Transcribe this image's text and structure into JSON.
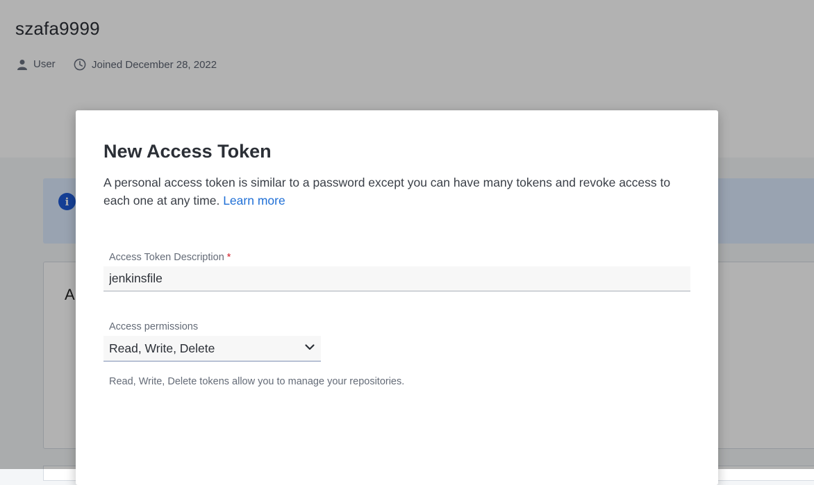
{
  "profile": {
    "username": "szafa9999",
    "role": "User",
    "joined": "Joined December 28, 2022"
  },
  "background": {
    "info_icon": "i",
    "card_heading_partial": "A"
  },
  "modal": {
    "title": "New Access Token",
    "description": "A personal access token is similar to a password except you can have many tokens and revoke access to each one at any time. ",
    "learn_more": "Learn more",
    "description_label": "Access Token Description",
    "required_marker": "*",
    "description_value": "jenkinsfile",
    "permissions_label": "Access permissions",
    "permissions_value": "Read, Write, Delete",
    "permissions_helper": "Read, Write, Delete tokens allow you to manage your repositories."
  },
  "icons": {
    "user": "user-icon",
    "clock": "clock-icon",
    "info": "info-icon",
    "chevron": "chevron-down-icon"
  },
  "colors": {
    "link": "#1f6fd6",
    "required": "#d1202a",
    "info": "#1f5bd6"
  }
}
